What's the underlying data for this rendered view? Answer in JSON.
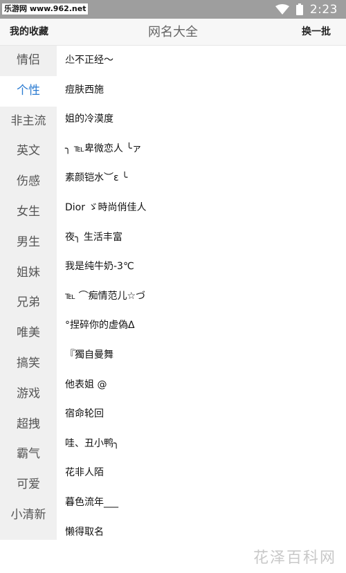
{
  "status_bar": {
    "watermark": "乐游网 www.962.net",
    "time": "2:23",
    "icons": [
      "wifi-icon",
      "battery-icon"
    ]
  },
  "app_bar": {
    "favorites_label": "我的收藏",
    "title": "网名大全",
    "refresh_label": "换一批"
  },
  "sidebar": {
    "active_index": 1,
    "items": [
      "情侣",
      "个性",
      "非主流",
      "英文",
      "伤感",
      "女生",
      "男生",
      "姐妹",
      "兄弟",
      "唯美",
      "搞笑",
      "游戏",
      "超拽",
      "霸气",
      "可爱",
      "小清新"
    ]
  },
  "names": [
    "尐不正经～",
    "痘肤西施",
    "姐的冷漠度",
    "╮ ℡卑微恋人 ╰ァ",
    "素颜铠水︶ε ╰",
    "Dior ゞ時尚俏佳人",
    "夜╮ 生活丰富",
    "我是纯牛奶-3℃",
    "℡ ⌒痴情范儿☆づ",
    "°捏碎你的虚偽Δ",
    "『獨自曼舞",
    "他表姐 @",
    "宿命轮回",
    "哇、丑小鸭╮",
    "花非人陌",
    "暮色流年___",
    "  懒得取名"
  ],
  "footer": {
    "brand": "花泽百科网"
  },
  "colors": {
    "status_bar": "#9e9e9e",
    "accent": "#2a7bd1",
    "sidebar_bg": "#f0f0f0"
  }
}
